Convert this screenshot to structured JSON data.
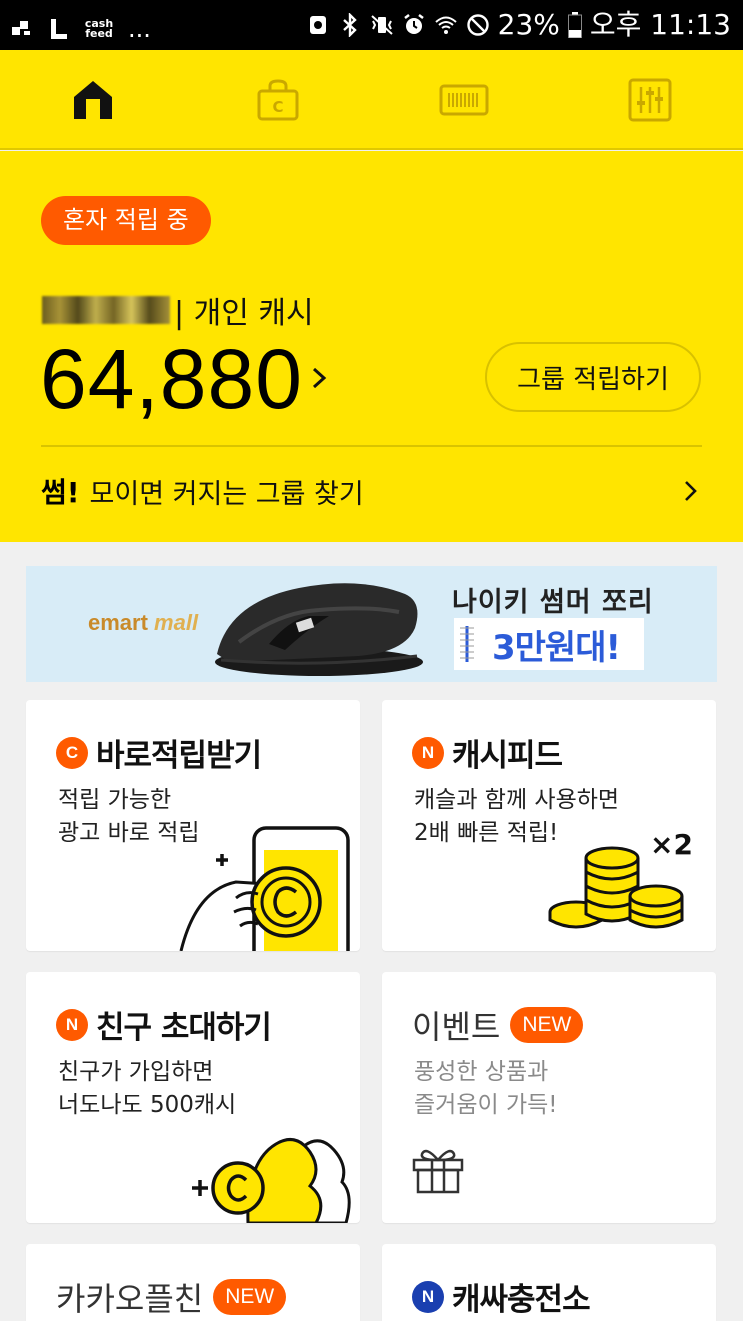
{
  "status_bar": {
    "app_badge": "cash\nfeed",
    "dots": "...",
    "battery": "23%",
    "time": "오후 11:13"
  },
  "nav": {
    "tabs": [
      "home",
      "shop",
      "barcode",
      "settings"
    ],
    "active": "home"
  },
  "hero": {
    "status_pill": "혼자 적립 중",
    "owner_suffix": "| 개인 캐시",
    "cash_amount": "64,880",
    "group_button": "그룹 적립하기",
    "promo_bold": "썸!",
    "promo_text": "모이면 커지는 그룹 찾기"
  },
  "banner": {
    "brand": "emart",
    "brand_suffix": "mall",
    "title": "나이키 썸머 쪼리",
    "price": "3만원대!"
  },
  "cards": [
    {
      "id": "direct-earn",
      "badge": "C",
      "badge_color": "#ff5a00",
      "title": "바로적립받기",
      "desc": [
        "적립 가능한",
        "광고 바로 적립"
      ]
    },
    {
      "id": "cash-feed",
      "badge": "N",
      "badge_color": "#ff5a00",
      "title": "캐시피드",
      "desc": [
        "캐슬과 함께 사용하면",
        "2배 빠른 적립!"
      ],
      "multiplier": "×2"
    },
    {
      "id": "invite-friend",
      "badge": "N",
      "badge_color": "#ff5a00",
      "title": "친구 초대하기",
      "desc": [
        "친구가 가입하면",
        "너도나도 500캐시"
      ]
    },
    {
      "id": "event",
      "title": "이벤트",
      "new_badge": "NEW",
      "desc": [
        "풍성한 상품과",
        "즐거움이 가득!"
      ]
    },
    {
      "id": "kakao-plus",
      "title": "카카오플친",
      "new_badge": "NEW"
    },
    {
      "id": "cash-charge",
      "badge": "N",
      "badge_color": "#1a3fb0",
      "title": "캐싸충전소"
    }
  ],
  "colors": {
    "brand_yellow": "#ffe500",
    "accent_orange": "#ff5a00",
    "navy": "#1a3fb0"
  }
}
